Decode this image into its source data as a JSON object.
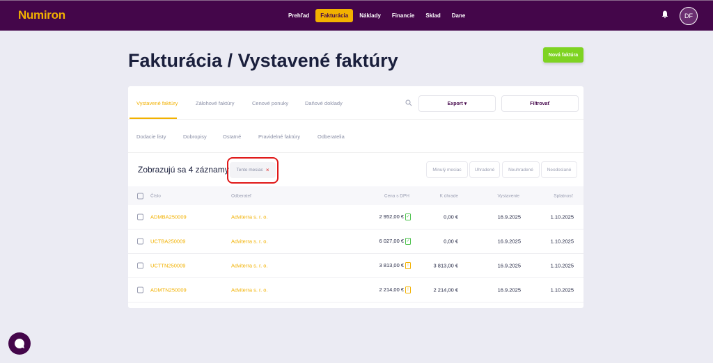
{
  "header": {
    "logo": "Numiron",
    "nav": [
      {
        "label": "Prehľad"
      },
      {
        "label": "Fakturácia",
        "active": true
      },
      {
        "label": "Náklady"
      },
      {
        "label": "Financie"
      },
      {
        "label": "Sklad"
      },
      {
        "label": "Dane"
      }
    ],
    "avatar": "DF"
  },
  "page": {
    "title": "Fakturácia / Vystavené faktúry",
    "new_button": "Nová faktúra"
  },
  "tabs_row1": [
    "Vystavené faktúry",
    "Zálohové faktúry",
    "Cenové ponuky",
    "Daňové doklady"
  ],
  "tabs_row2": [
    "Dodacie listy",
    "Dobropisy",
    "Ostatné",
    "Pravidelné faktúry",
    "Odberatelia"
  ],
  "toolbar": {
    "export": "Export ▾",
    "filter": "Filtrovať"
  },
  "summary": {
    "count": "Zobrazujú sa 4 záznamy",
    "chip": "Tento mesiac",
    "chip_close": "×"
  },
  "filters": [
    "Minulý mesiac",
    "Uhradené",
    "Neuhradené",
    "Neodoslané"
  ],
  "table": {
    "headers": [
      "Číslo",
      "Odberateľ",
      "Cena s DPH",
      "K úhrade",
      "Vystavenie",
      "Splatnosť"
    ],
    "rows": [
      {
        "number": "ADMBA250009",
        "customer": "Adviterra s. r. o.",
        "price": "2 952,00 €",
        "status": "paid",
        "due": "0,00 €",
        "issued": "16.9.2025",
        "maturity": "1.10.2025"
      },
      {
        "number": "UCTBA250009",
        "customer": "Adviterra s. r. o.",
        "price": "6 027,00 €",
        "status": "paid",
        "due": "0,00 €",
        "issued": "16.9.2025",
        "maturity": "1.10.2025"
      },
      {
        "number": "UCTTN250009",
        "customer": "Adviterra s. r. o.",
        "price": "3 813,00 €",
        "status": "unpaid",
        "due": "3 813,00 €",
        "issued": "16.9.2025",
        "maturity": "1.10.2025"
      },
      {
        "number": "ADMTN250009",
        "customer": "Adviterra s. r. o.",
        "price": "2 214,00 €",
        "status": "unpaid",
        "due": "2 214,00 €",
        "issued": "16.9.2025",
        "maturity": "1.10.2025"
      }
    ]
  },
  "colors": {
    "header": "#44064a",
    "accent": "#f2b100",
    "primary_button": "#7ed321",
    "highlight": "#e01818"
  }
}
